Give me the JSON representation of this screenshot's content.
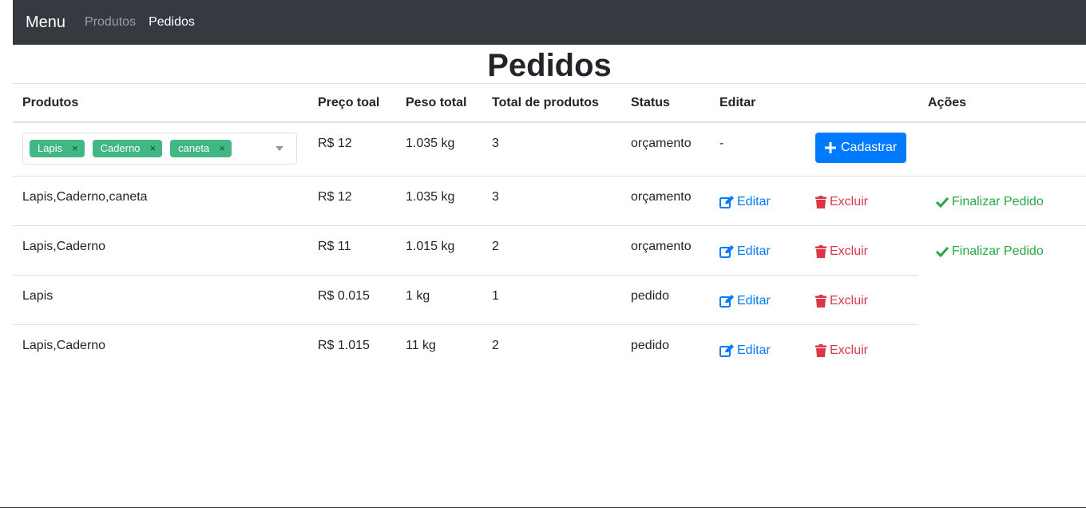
{
  "navbar": {
    "brand": "Menu",
    "links": [
      {
        "label": "Produtos"
      },
      {
        "label": "Pedidos"
      }
    ]
  },
  "page_title": "Pedidos",
  "table": {
    "headers": [
      "Produtos",
      "Preço toal",
      "Peso total",
      "Total de produtos",
      "Status",
      "Editar",
      "",
      "Ações"
    ],
    "form_row": {
      "selected_tags": [
        "Lapis",
        "Caderno",
        "caneta"
      ],
      "tag_remove": "×",
      "price": "R$ 12",
      "weight": "1.035 kg",
      "count": "3",
      "status": "orçamento",
      "edit_placeholder": "-",
      "submit_label": "Cadastrar"
    },
    "rows": [
      {
        "products": "Lapis,Caderno,caneta",
        "price": "R$ 12",
        "weight": "1.035 kg",
        "count": "3",
        "status": "orçamento",
        "edit": "Editar",
        "delete": "Excluir",
        "finalize": "Finalizar Pedido"
      },
      {
        "products": "Lapis,Caderno",
        "price": "R$ 11",
        "weight": "1.015 kg",
        "count": "2",
        "status": "orçamento",
        "edit": "Editar",
        "delete": "Excluir",
        "finalize": "Finalizar Pedido"
      },
      {
        "products": "Lapis",
        "price": "R$ 0.015",
        "weight": "1 kg",
        "count": "1",
        "status": "pedido",
        "edit": "Editar",
        "delete": "Excluir"
      },
      {
        "products": "Lapis,Caderno",
        "price": "R$ 1.015",
        "weight": "11 kg",
        "count": "2",
        "status": "pedido",
        "edit": "Editar",
        "delete": "Excluir"
      }
    ]
  },
  "colors": {
    "navbar_bg": "#343a40",
    "primary": "#007bff",
    "danger": "#dc3545",
    "success": "#28a745",
    "tag": "#41b883"
  },
  "icons": {
    "add": "plus-icon",
    "edit": "edit-icon",
    "delete": "trash-icon",
    "finalize": "check-icon"
  }
}
